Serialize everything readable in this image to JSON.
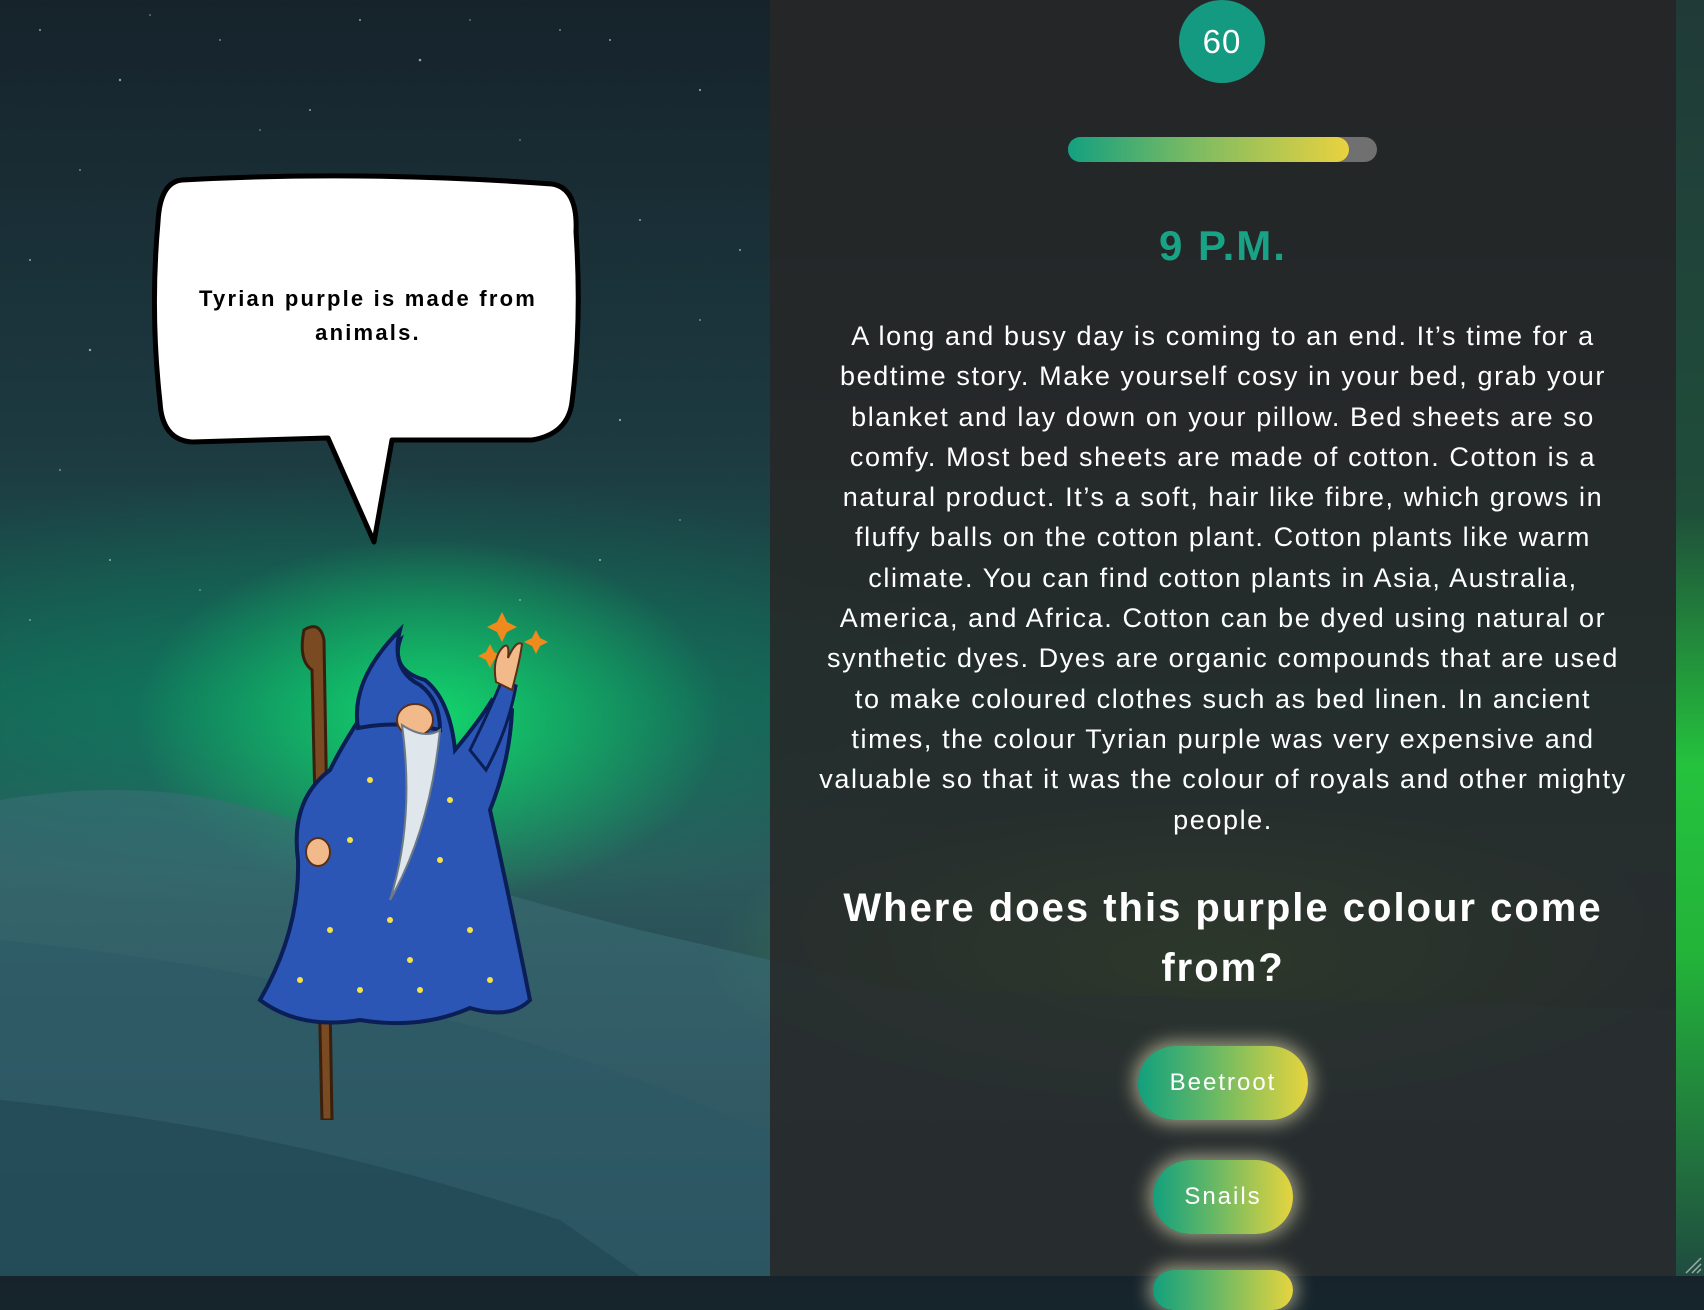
{
  "timer": {
    "value": "60"
  },
  "progress": {
    "fraction": 0.91
  },
  "story": {
    "time_label": "9 P.M.",
    "text": "A long and busy day is coming to an end. It’s time for a bedtime story. Make yourself cosy in your bed, grab your blanket and lay down on your pillow. Bed sheets are so comfy. Most bed sheets are made of cotton. Cotton is a natural product. It’s a soft, hair like fibre, which grows in fluffy balls on the cotton plant. Cotton plants like warm climate. You can find cotton plants in Asia, Australia, America, and Africa. Cotton can be dyed using natural or synthetic dyes. Dyes are organic compounds that are used to make coloured clothes such as bed linen. In ancient times, the colour Tyrian purple was very expensive and valuable so that it was the colour of royals and other mighty people."
  },
  "quiz": {
    "question": "Where does this purple colour come from?",
    "answers": [
      "Beetroot",
      "Snails",
      ""
    ]
  },
  "wizard": {
    "speech": "Tyrian purple is made from animals.",
    "icon": "wizard-icon"
  },
  "colors": {
    "accent": "#159a82",
    "gradient_start": "#12a07e",
    "gradient_end": "#e6d43e",
    "panel": "#262626"
  }
}
